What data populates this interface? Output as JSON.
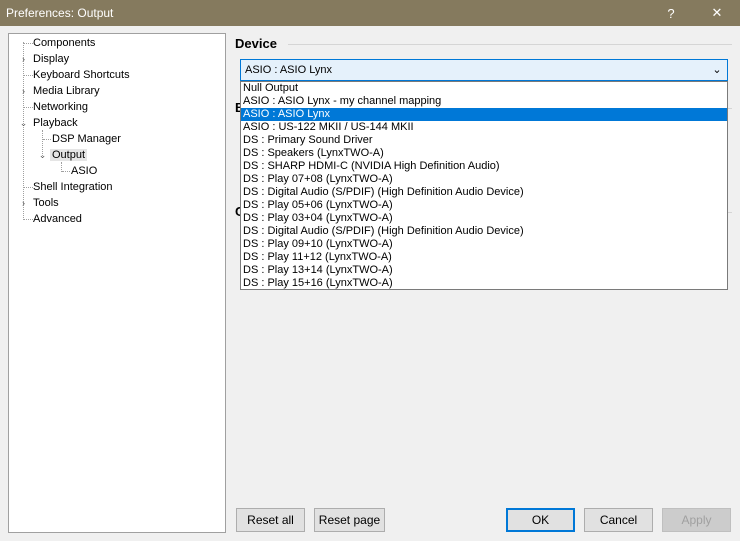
{
  "window": {
    "title": "Preferences: Output",
    "help_label": "?",
    "close_label": "✕"
  },
  "tree": {
    "expand_glyph": "›",
    "collapse_glyph": "⌄",
    "items": [
      {
        "label": "Components"
      },
      {
        "label": "Display"
      },
      {
        "label": "Keyboard Shortcuts"
      },
      {
        "label": "Media Library"
      },
      {
        "label": "Networking"
      },
      {
        "label": "Playback"
      },
      {
        "label": "DSP Manager"
      },
      {
        "label": "Output"
      },
      {
        "label": "ASIO"
      },
      {
        "label": "Shell Integration"
      },
      {
        "label": "Tools"
      },
      {
        "label": "Advanced"
      }
    ]
  },
  "device": {
    "heading": "Device",
    "selected_value": "ASIO : ASIO Lynx",
    "options": [
      "Null Output",
      "ASIO : ASIO Lynx - my channel mapping",
      "ASIO : ASIO Lynx",
      "ASIO : US-122 MKII / US-144 MKII",
      "DS : Primary Sound Driver",
      "DS : Speakers (LynxTWO-A)",
      "DS : SHARP HDMI-C (NVIDIA High Definition Audio)",
      "DS : Play 07+08 (LynxTWO-A)",
      "DS : Digital Audio (S/PDIF) (High Definition Audio Device)",
      "DS : Play 05+06 (LynxTWO-A)",
      "DS : Play 03+04 (LynxTWO-A)",
      "DS : Digital Audio (S/PDIF) (High Definition Audio Device)",
      "DS : Play 09+10 (LynxTWO-A)",
      "DS : Play 11+12 (LynxTWO-A)",
      "DS : Play 13+14 (LynxTWO-A)",
      "DS : Play 15+16 (LynxTWO-A)"
    ],
    "selected_index": 2,
    "arrow_glyph": "⌄"
  },
  "partial_headings": {
    "buffer_letter": "B",
    "output_letter": "C"
  },
  "buttons": {
    "reset_all": "Reset all",
    "reset_page": "Reset page",
    "ok": "OK",
    "cancel": "Cancel",
    "apply": "Apply"
  },
  "colors": {
    "titlebar": "#857a5e",
    "selection": "#0078d7",
    "default_button_border": "#0078d7"
  }
}
